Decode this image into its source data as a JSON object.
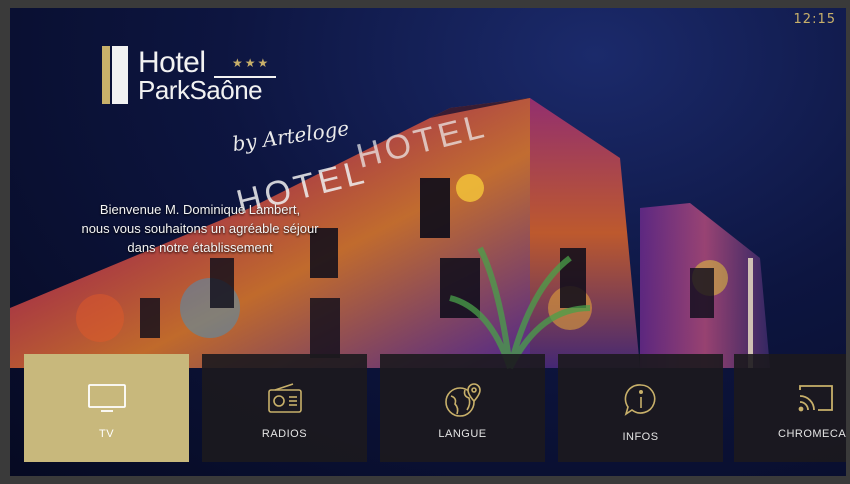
{
  "clock": "12:15",
  "hotel": {
    "line1": "Hotel",
    "line2": "ParkSaône",
    "stars": "★★★",
    "subtitle": "by Arteloge"
  },
  "welcome": {
    "line1": "Bienvenue M. Dominique Lambert,",
    "line2": "nous vous souhaitons un agréable séjour",
    "line3": "dans notre établissement"
  },
  "menu": [
    {
      "label": "TV",
      "icon": "tv-icon",
      "active": true
    },
    {
      "label": "RADIOS",
      "icon": "radio-icon",
      "active": false
    },
    {
      "label": "LANGUE",
      "icon": "globe-location-icon",
      "active": false
    },
    {
      "label": "INFOS",
      "icon": "info-bubble-icon",
      "active": false
    },
    {
      "label": "CHROMECA",
      "icon": "cast-icon",
      "active": false
    }
  ],
  "colors": {
    "accent": "#c8b06a",
    "active_tile": "#c8b87c"
  }
}
